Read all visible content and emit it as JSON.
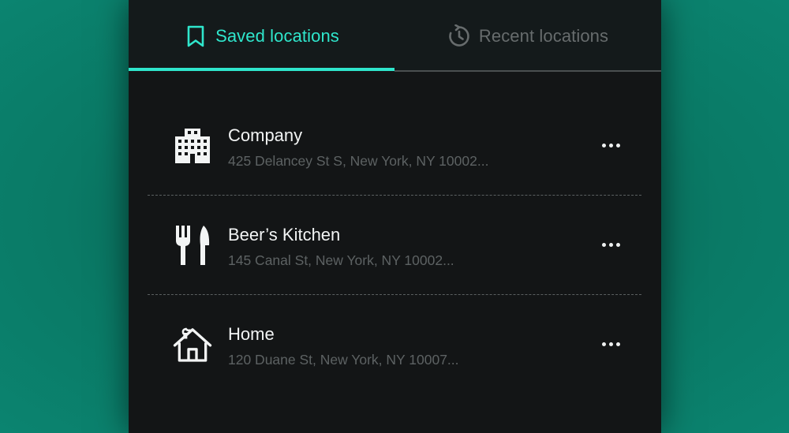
{
  "tabs": {
    "saved": {
      "label": "Saved locations",
      "icon": "bookmark-icon",
      "active": true
    },
    "recent": {
      "label": "Recent locations",
      "icon": "history-icon",
      "active": false
    }
  },
  "colors": {
    "accent": "#2fe6cc",
    "background": "#131516",
    "inactive_text": "#676c6d",
    "page_background": "#0a7a66"
  },
  "locations": [
    {
      "title": "Company",
      "address": "425 Delancey St S, New York, NY 10002...",
      "icon": "office-building-icon"
    },
    {
      "title": "Beer’s Kitchen",
      "address": "145 Canal St, New York, NY 10002...",
      "icon": "restaurant-icon"
    },
    {
      "title": "Home",
      "address": "120 Duane St, New York, NY 10007...",
      "icon": "home-icon"
    }
  ]
}
